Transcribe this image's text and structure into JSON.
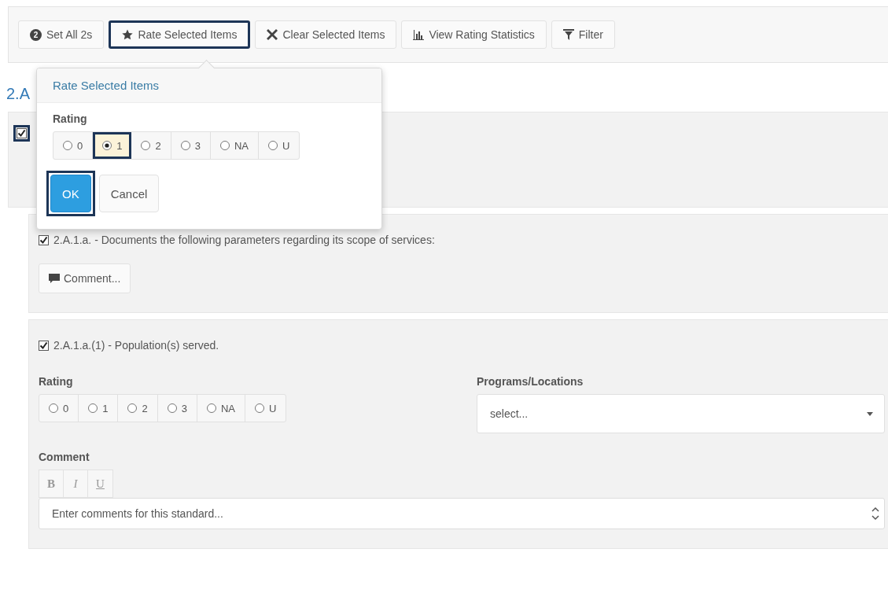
{
  "toolbar": {
    "buttons": [
      {
        "kind": "badge",
        "badge": "2",
        "label": "Set All 2s",
        "highlighted": false
      },
      {
        "kind": "star",
        "label": "Rate Selected Items",
        "highlighted": true
      },
      {
        "kind": "cross",
        "label": "Clear Selected Items",
        "highlighted": false
      },
      {
        "kind": "chart",
        "label": "View Rating Statistics",
        "highlighted": false
      },
      {
        "kind": "filter",
        "label": "Filter",
        "highlighted": false
      }
    ]
  },
  "popover": {
    "title": "Rate Selected Items",
    "rating_label": "Rating",
    "options": [
      {
        "label": "0",
        "selected": false,
        "highlighted": false
      },
      {
        "label": "1",
        "selected": true,
        "highlighted": true
      },
      {
        "label": "2",
        "selected": false,
        "highlighted": false
      },
      {
        "label": "3",
        "selected": false,
        "highlighted": false
      },
      {
        "label": "NA",
        "selected": false,
        "highlighted": false
      },
      {
        "label": "U",
        "selected": false,
        "highlighted": false
      }
    ],
    "buttons": [
      {
        "kind": "primary",
        "label": "OK",
        "highlighted": true
      },
      {
        "kind": "default",
        "label": "Cancel",
        "highlighted": false
      }
    ]
  },
  "section": {
    "heading": "2.A",
    "checked": true,
    "checkbox_highlighted": true
  },
  "items": [
    {
      "kind": "comment-only",
      "checked": true,
      "text": "2.A.1.a. - Documents the following parameters regarding its scope of services:",
      "comment_button": "Comment..."
    },
    {
      "kind": "full",
      "checked": true,
      "text": "2.A.1.a.(1) - Population(s) served.",
      "rating_label": "Rating",
      "options": [
        {
          "label": "0",
          "selected": false
        },
        {
          "label": "1",
          "selected": false
        },
        {
          "label": "2",
          "selected": false
        },
        {
          "label": "3",
          "selected": false
        },
        {
          "label": "NA",
          "selected": false
        },
        {
          "label": "U",
          "selected": false
        }
      ],
      "programs_label": "Programs/Locations",
      "programs_placeholder": "select...",
      "comment_label": "Comment",
      "format_buttons": [
        "B",
        "I",
        "U"
      ],
      "comment_placeholder": "Enter comments for this standard..."
    }
  ]
}
